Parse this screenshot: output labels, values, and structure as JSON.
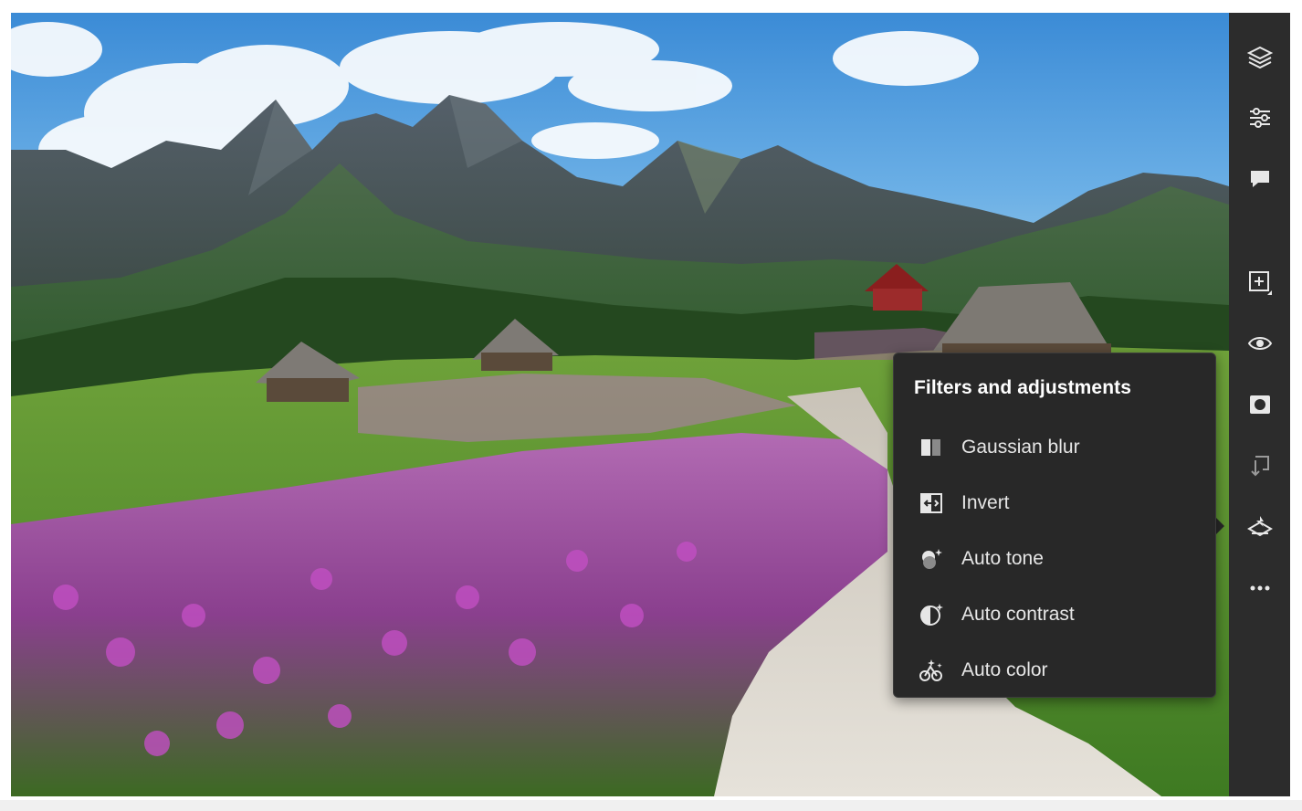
{
  "canvas": {
    "description_icon": "landscape-photo"
  },
  "toolbar": {
    "items": [
      {
        "icon": "layers-icon"
      },
      {
        "icon": "adjustments-sliders-icon"
      },
      {
        "icon": "comment-icon"
      },
      {
        "icon": "add-layer-icon"
      },
      {
        "icon": "visibility-eye-icon"
      },
      {
        "icon": "mask-icon"
      },
      {
        "icon": "clip-icon"
      },
      {
        "icon": "filters-icon"
      },
      {
        "icon": "more-icon"
      }
    ]
  },
  "flyout": {
    "title": "Filters and adjustments",
    "items": [
      {
        "label": "Gaussian blur",
        "icon": "gaussian-blur-icon"
      },
      {
        "label": "Invert",
        "icon": "invert-icon"
      },
      {
        "label": "Auto tone",
        "icon": "auto-tone-icon"
      },
      {
        "label": "Auto contrast",
        "icon": "auto-contrast-icon"
      },
      {
        "label": "Auto color",
        "icon": "auto-color-icon"
      }
    ]
  },
  "colors": {
    "toolbar_bg": "#2c2c2c",
    "flyout_bg": "#282828",
    "icon": "#e8e8e8",
    "text": "#e6e6e6"
  }
}
